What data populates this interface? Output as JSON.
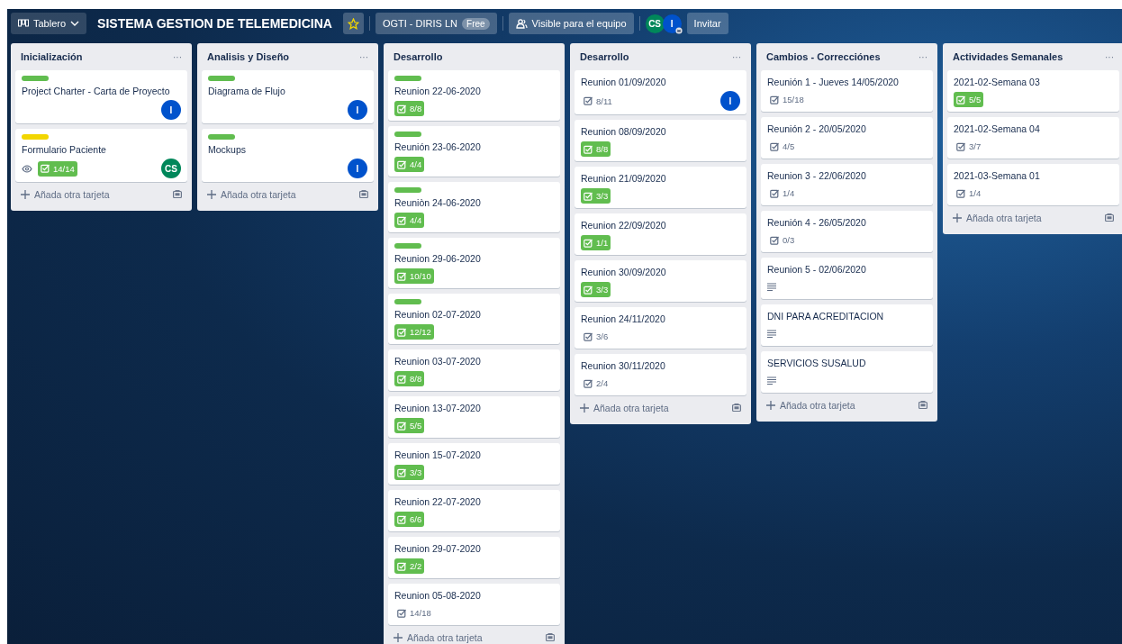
{
  "header": {
    "board_switcher": "Tablero",
    "board_title": "SISTEMA GESTION DE TELEMEDICINA",
    "starred": true,
    "workspace": "OGTI - DIRIS LN",
    "workspace_plan": "Free",
    "visibility": "Visible para el equipo",
    "members": [
      {
        "initials": "CS",
        "color": "#00875a",
        "admin": false
      },
      {
        "initials": "I",
        "color": "#0052cc",
        "admin": true
      }
    ],
    "invite": "Invitar"
  },
  "lists": [
    {
      "title": "Inicialización",
      "menu": "···",
      "add_card": "Añada otra tarjeta",
      "cards": [
        {
          "label": {
            "color": "#61bd4f"
          },
          "title": "Project Charter - Carta de Proyecto",
          "members": [
            {
              "initials": "I",
              "color": "#0052cc"
            }
          ]
        },
        {
          "label": {
            "color": "#f2d600"
          },
          "title": "Formulario Paciente",
          "watching": true,
          "checklist": {
            "text": "14/14",
            "complete": true
          },
          "members": [
            {
              "initials": "CS",
              "color": "#00875a"
            }
          ]
        }
      ]
    },
    {
      "title": "Analisis y Diseño",
      "menu": "···",
      "add_card": "Añada otra tarjeta",
      "cards": [
        {
          "label": {
            "color": "#61bd4f"
          },
          "title": "Diagrama de Flujo",
          "members": [
            {
              "initials": "I",
              "color": "#0052cc"
            }
          ]
        },
        {
          "label": {
            "color": "#61bd4f"
          },
          "title": "Mockups",
          "members": [
            {
              "initials": "I",
              "color": "#0052cc"
            }
          ]
        }
      ]
    },
    {
      "title": "Desarrollo",
      "add_card": "Añada otra tarjeta",
      "cards": [
        {
          "label": {
            "color": "#61bd4f"
          },
          "title": "Reunion 22-06-2020",
          "checklist": {
            "text": "8/8",
            "complete": true
          }
        },
        {
          "label": {
            "color": "#61bd4f"
          },
          "title": "Reunión 23-06-2020",
          "checklist": {
            "text": "4/4",
            "complete": true
          }
        },
        {
          "label": {
            "color": "#61bd4f"
          },
          "title": "Reuniòn 24-06-2020",
          "checklist": {
            "text": "4/4",
            "complete": true
          }
        },
        {
          "label": {
            "color": "#61bd4f"
          },
          "title": "Reunion 29-06-2020",
          "checklist": {
            "text": "10/10",
            "complete": true
          }
        },
        {
          "label": {
            "color": "#61bd4f"
          },
          "title": "Reunion 02-07-2020",
          "checklist": {
            "text": "12/12",
            "complete": true
          }
        },
        {
          "title": "Reunion 03-07-2020",
          "checklist": {
            "text": "8/8",
            "complete": true
          }
        },
        {
          "title": "Reunion 13-07-2020",
          "checklist": {
            "text": "5/5",
            "complete": true
          }
        },
        {
          "title": "Reunion 15-07-2020",
          "checklist": {
            "text": "3/3",
            "complete": true
          }
        },
        {
          "title": "Reunion 22-07-2020",
          "checklist": {
            "text": "6/6",
            "complete": true
          }
        },
        {
          "title": "Reunion 29-07-2020",
          "checklist": {
            "text": "2/2",
            "complete": true
          }
        },
        {
          "title": "Reunion 05-08-2020",
          "checklist": {
            "text": "14/18",
            "complete": false
          }
        }
      ]
    },
    {
      "title": "Desarrollo",
      "menu": "···",
      "add_card": "Añada otra tarjeta",
      "cards": [
        {
          "title": "Reunion 01/09/2020",
          "checklist": {
            "text": "8/11",
            "complete": false
          },
          "members": [
            {
              "initials": "I",
              "color": "#0052cc"
            }
          ]
        },
        {
          "title": "Reunion 08/09/2020",
          "checklist": {
            "text": "8/8",
            "complete": true
          }
        },
        {
          "title": "Reunion 21/09/2020",
          "checklist": {
            "text": "3/3",
            "complete": true
          }
        },
        {
          "title": "Reunion 22/09/2020",
          "checklist": {
            "text": "1/1",
            "complete": true
          }
        },
        {
          "title": "Reunion 30/09/2020",
          "checklist": {
            "text": "3/3",
            "complete": true
          }
        },
        {
          "title": "Reunion 24/11/2020",
          "checklist": {
            "text": "3/6",
            "complete": false
          }
        },
        {
          "title": "Reunion 30/11/2020",
          "checklist": {
            "text": "2/4",
            "complete": false
          }
        }
      ]
    },
    {
      "title": "Cambios - Correcciónes",
      "menu": "···",
      "add_card": "Añada otra tarjeta",
      "cards": [
        {
          "title": "Reunión 1 - Jueves 14/05/2020",
          "checklist": {
            "text": "15/18",
            "complete": false
          }
        },
        {
          "title": "Reunión 2 - 20/05/2020",
          "checklist": {
            "text": "4/5",
            "complete": false
          }
        },
        {
          "title": "Reunion 3 - 22/06/2020",
          "checklist": {
            "text": "1/4",
            "complete": false
          }
        },
        {
          "title": "Reunión 4 - 26/05/2020",
          "checklist": {
            "text": "0/3",
            "complete": false
          }
        },
        {
          "title": "Reunion 5 - 02/06/2020",
          "description": true
        },
        {
          "title": "DNI PARA ACREDITACION",
          "description": true
        },
        {
          "title": "SERVICIOS SUSALUD",
          "description": true
        }
      ]
    },
    {
      "title": "Actividades Semanales",
      "menu": "···",
      "add_card": "Añada otra tarjeta",
      "cards": [
        {
          "title": "2021-02-Semana 03",
          "checklist": {
            "text": "5/5",
            "complete": true
          }
        },
        {
          "title": "2021-02-Semana 04",
          "checklist": {
            "text": "3/7",
            "complete": false
          }
        },
        {
          "title": "2021-03-Semana 01",
          "checklist": {
            "text": "1/4",
            "complete": false
          }
        }
      ]
    }
  ]
}
